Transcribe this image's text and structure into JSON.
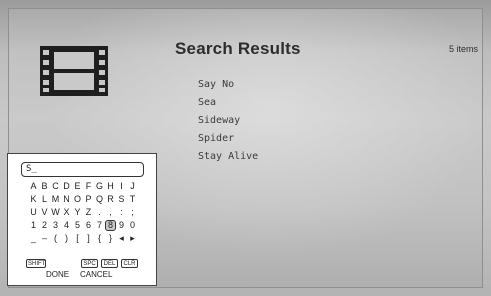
{
  "screen": {
    "title": "Search Results",
    "item_count": "5 items",
    "icon": "film-strip-icon"
  },
  "results": [
    "Say No",
    "Sea",
    "Sideway",
    "Spider",
    "Stay Alive"
  ],
  "keyboard": {
    "input_value": "S_",
    "rows": [
      [
        "A",
        "B",
        "C",
        "D",
        "E",
        "F",
        "G",
        "H",
        "I",
        "J"
      ],
      [
        "K",
        "L",
        "M",
        "N",
        "O",
        "P",
        "Q",
        "R",
        "S",
        "T"
      ],
      [
        "U",
        "V",
        "W",
        "X",
        "Y",
        "Z",
        ".",
        ",",
        ":",
        ";"
      ],
      [
        "1",
        "2",
        "3",
        "4",
        "5",
        "6",
        "7",
        "8",
        "9",
        "0"
      ],
      [
        "_",
        "‒",
        "(",
        ")",
        "[",
        "]",
        "{",
        "}",
        "◂",
        "▸"
      ]
    ],
    "selected_key": "8",
    "util_keys": {
      "shift": "SHIFT",
      "space": "SPC",
      "delete": "DEL",
      "clear": "CLR"
    },
    "done_label": "DONE",
    "cancel_label": "CANCEL"
  },
  "colors": {
    "text": "#2d2d2d",
    "panel_bg": "#ffffff",
    "selected_key_bg": "#c9c9c9"
  }
}
